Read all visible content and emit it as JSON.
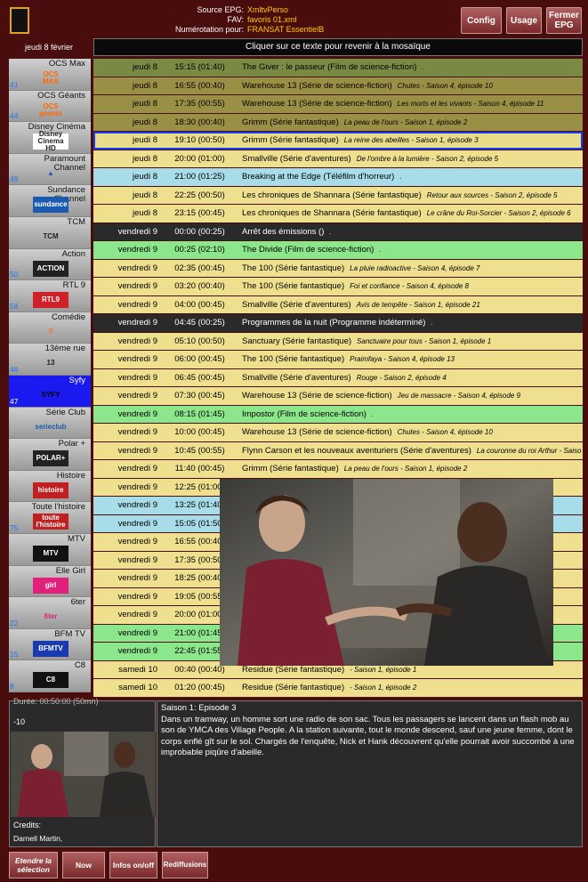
{
  "header": {
    "source_label": "Source EPG:",
    "source_value": "XmltvPerso",
    "fav_label": "FAV:",
    "fav_value": "favoris 01.xml",
    "num_label": "Numérotation pour:",
    "num_value": "FRANSAT EssentielB",
    "config": "Config",
    "usage": "Usage",
    "close_epg": "Fermer EPG"
  },
  "date_label": "jeudi 8 février",
  "mosaic_hint": "Cliquer sur ce texte pour revenir à la mosaïque",
  "channels": [
    {
      "name": "OCS Max",
      "num": "41",
      "logo": "OCS\nMAX",
      "logo_color": "#ff6a00",
      "logo_bg": "transparent"
    },
    {
      "name": "OCS Géants",
      "num": "44",
      "logo": "OCS\ngéants",
      "logo_color": "#ff6a00",
      "logo_bg": "transparent"
    },
    {
      "name": "Disney Cinéma",
      "num": "",
      "logo": "Disney\nCinema HD",
      "logo_color": "#222",
      "logo_bg": "#fff"
    },
    {
      "name": "Paramount\nChannel",
      "num": "49",
      "logo": "▲",
      "logo_color": "#1a5ab0",
      "logo_bg": "transparent"
    },
    {
      "name": "Sundance\nChannel",
      "num": "",
      "logo": "sundance",
      "logo_color": "#fff",
      "logo_bg": "#1a5ab0"
    },
    {
      "name": "TCM",
      "num": "",
      "logo": "TCM",
      "logo_color": "#222",
      "logo_bg": "transparent"
    },
    {
      "name": "Action",
      "num": "50",
      "logo": "ACTION",
      "logo_color": "#fff",
      "logo_bg": "#222"
    },
    {
      "name": "RTL 9",
      "num": "58",
      "logo": "RTL9",
      "logo_color": "#fff",
      "logo_bg": "#d0202a"
    },
    {
      "name": "Comédie",
      "num": "",
      "logo": "!!",
      "logo_color": "#ff6a00",
      "logo_bg": "transparent"
    },
    {
      "name": "13ème rue",
      "num": "46",
      "logo": "13",
      "logo_color": "#222",
      "logo_bg": "transparent"
    },
    {
      "name": "Syfy",
      "num": "47",
      "logo": "SYFY",
      "logo_color": "#000",
      "logo_bg": "transparent",
      "selected": true
    },
    {
      "name": "Série Club",
      "num": "",
      "logo": "serieclub",
      "logo_color": "#1a5ab0",
      "logo_bg": "transparent"
    },
    {
      "name": "Polar +",
      "num": "",
      "logo": "POLAR+",
      "logo_color": "#fff",
      "logo_bg": "#222"
    },
    {
      "name": "Histoire",
      "num": "",
      "logo": "histoire",
      "logo_color": "#fff",
      "logo_bg": "#c02020"
    },
    {
      "name": "Toute l'histoire",
      "num": "75",
      "logo": "toute\nl'histoire",
      "logo_color": "#fff",
      "logo_bg": "#c02020"
    },
    {
      "name": "MTV",
      "num": "",
      "logo": "MTV",
      "logo_color": "#fff",
      "logo_bg": "#111"
    },
    {
      "name": "Elle Girl",
      "num": "",
      "logo": "girl",
      "logo_color": "#fff",
      "logo_bg": "#e0207a"
    },
    {
      "name": "6ter",
      "num": "22",
      "logo": "6ter",
      "logo_color": "#e0207a",
      "logo_bg": "transparent"
    },
    {
      "name": "BFM TV",
      "num": "15",
      "logo": "BFMTV",
      "logo_color": "#fff",
      "logo_bg": "#1a3ab0"
    },
    {
      "name": "C8",
      "num": "8",
      "logo": "C8",
      "logo_color": "#fff",
      "logo_bg": "#111"
    }
  ],
  "colors": {
    "yellow": "#efe090",
    "olive": "#9a9045",
    "green": "#7a8a45",
    "lightgreen": "#8ce68c",
    "blue": "#a8dce8",
    "dark": "#2a2a2a",
    "current": "#e8dd8a"
  },
  "rows": [
    {
      "d": "jeudi 8",
      "t": "15:15 (01:40)",
      "ti": "The Giver : le passeur  (Film de science-fiction)",
      "ep": " .",
      "c": "green"
    },
    {
      "d": "jeudi 8",
      "t": "16:55 (00:40)",
      "ti": "Warehouse 13  (Série de science-fiction)",
      "ep": "Chutes - Saison 4, épisode 10",
      "c": "olive"
    },
    {
      "d": "jeudi 8",
      "t": "17:35 (00:55)",
      "ti": "Warehouse 13  (Série de science-fiction)",
      "ep": "Les morts et les vivants - Saison 4, épisode 11",
      "c": "olive"
    },
    {
      "d": "jeudi 8",
      "t": "18:30 (00:40)",
      "ti": "Grimm  (Série fantastique)",
      "ep": "La peau de l'ours - Saison 1, épisode 2",
      "c": "olive"
    },
    {
      "d": "jeudi 8",
      "t": "19:10 (00:50)",
      "ti": "Grimm  (Série fantastique)",
      "ep": "La reine des abeilles - Saison 1, épisode 3",
      "c": "current",
      "cur": true
    },
    {
      "d": "jeudi 8",
      "t": "20:00 (01:00)",
      "ti": "Smallville  (Série d'aventures)",
      "ep": "De l'ombre à la lumière - Saison 2, épisode 5",
      "c": "yellow"
    },
    {
      "d": "jeudi 8",
      "t": "21:00 (01:25)",
      "ti": "Breaking at the Edge  (Téléfilm d'horreur)",
      "ep": " .",
      "c": "blue"
    },
    {
      "d": "jeudi 8",
      "t": "22:25 (00:50)",
      "ti": "Les chroniques de Shannara  (Série fantastique)",
      "ep": "Retour aux sources - Saison 2, épisode 5",
      "c": "yellow"
    },
    {
      "d": "jeudi 8",
      "t": "23:15 (00:45)",
      "ti": "Les chroniques de Shannara  (Série fantastique)",
      "ep": "Le crâne du Roi-Sorcier - Saison 2, épisode 6",
      "c": "yellow"
    },
    {
      "d": "vendredi 9",
      "t": "00:00 (00:25)",
      "ti": "Arrêt des émissions  ()",
      "ep": " .",
      "c": "dark"
    },
    {
      "d": "vendredi 9",
      "t": "00:25 (02:10)",
      "ti": "The Divide  (Film de science-fiction)",
      "ep": " .",
      "c": "lightgreen"
    },
    {
      "d": "vendredi 9",
      "t": "02:35 (00:45)",
      "ti": "The 100  (Série fantastique)",
      "ep": "La pluie radioactive - Saison 4, épisode 7",
      "c": "yellow"
    },
    {
      "d": "vendredi 9",
      "t": "03:20 (00:40)",
      "ti": "The 100  (Série fantastique)",
      "ep": "Foi et confiance - Saison 4, épisode 8",
      "c": "yellow"
    },
    {
      "d": "vendredi 9",
      "t": "04:00 (00:45)",
      "ti": "Smallville  (Série d'aventures)",
      "ep": "Avis de tempête - Saison 1, épisode 21",
      "c": "yellow"
    },
    {
      "d": "vendredi 9",
      "t": "04:45 (00:25)",
      "ti": "Programmes de la nuit  (Programme indéterminé)",
      "ep": " .",
      "c": "dark"
    },
    {
      "d": "vendredi 9",
      "t": "05:10 (00:50)",
      "ti": "Sanctuary  (Série fantastique)",
      "ep": "Sanctuaire pour tous - Saison 1, épisode 1",
      "c": "yellow"
    },
    {
      "d": "vendredi 9",
      "t": "06:00 (00:45)",
      "ti": "The 100  (Série fantastique)",
      "ep": "Praimfaya - Saison 4, épisode 13",
      "c": "yellow"
    },
    {
      "d": "vendredi 9",
      "t": "06:45 (00:45)",
      "ti": "Smallville  (Série d'aventures)",
      "ep": "Rouge - Saison 2, épisode 4",
      "c": "yellow"
    },
    {
      "d": "vendredi 9",
      "t": "07:30 (00:45)",
      "ti": "Warehouse 13  (Série de science-fiction)",
      "ep": "Jeu de massacre - Saison 4, épisode 9",
      "c": "yellow"
    },
    {
      "d": "vendredi 9",
      "t": "08:15 (01:45)",
      "ti": "Impostor  (Film de science-fiction)",
      "ep": " .",
      "c": "lightgreen"
    },
    {
      "d": "vendredi 9",
      "t": "10:00 (00:45)",
      "ti": "Warehouse 13  (Série de science-fiction)",
      "ep": "Chutes - Saison 4, épisode 10",
      "c": "yellow"
    },
    {
      "d": "vendredi 9",
      "t": "10:45 (00:55)",
      "ti": "Flynn Carson et les nouveaux aventuriers  (Série d'aventures)",
      "ep": "La couronne du roi Arthur - Saiso",
      "c": "yellow"
    },
    {
      "d": "vendredi 9",
      "t": "11:40 (00:45)",
      "ti": "Grimm  (Série fantastique)",
      "ep": "La peau de l'ours - Saison 1, épisode 2",
      "c": "yellow"
    },
    {
      "d": "vendredi 9",
      "t": "12:25 (01:00)",
      "ti": "",
      "ep": "",
      "c": "yellow"
    },
    {
      "d": "vendredi 9",
      "t": "13:25 (01:40)",
      "ti": "",
      "ep": "",
      "c": "blue"
    },
    {
      "d": "vendredi 9",
      "t": "15:05 (01:50)",
      "ti": "",
      "ep": "",
      "c": "blue"
    },
    {
      "d": "vendredi 9",
      "t": "16:55 (00:40)",
      "ti": "",
      "ep": "",
      "c": "yellow"
    },
    {
      "d": "vendredi 9",
      "t": "17:35 (00:50)",
      "ti": "",
      "ep": "",
      "c": "yellow"
    },
    {
      "d": "vendredi 9",
      "t": "18:25 (00:40)",
      "ti": "",
      "ep": "",
      "c": "yellow"
    },
    {
      "d": "vendredi 9",
      "t": "19:05 (00:55)",
      "ti": "",
      "ep": "",
      "c": "yellow"
    },
    {
      "d": "vendredi 9",
      "t": "20:00 (01:00)",
      "ti": "",
      "ep": "",
      "c": "yellow"
    },
    {
      "d": "vendredi 9",
      "t": "21:00 (01:45)",
      "ti": "",
      "ep": "",
      "c": "lightgreen"
    },
    {
      "d": "vendredi 9",
      "t": "22:45 (01:55)",
      "ti": "",
      "ep": "",
      "c": "lightgreen"
    },
    {
      "d": "samedi 10",
      "t": "00:40 (00:40)",
      "ti": "Residue  (Série fantastique)",
      "ep": " - Saison 1, épisode 1",
      "c": "yellow"
    },
    {
      "d": "samedi 10",
      "t": "01:20 (00:45)",
      "ti": "Residue  (Série fantastique)",
      "ep": " - Saison 1, épisode 2",
      "c": "yellow"
    }
  ],
  "info": {
    "duration": "Durée: 00:50:00 (50mn)",
    "rating": "-10",
    "credits_label": "Credits:",
    "credits": "Darnell Martin,",
    "episode_title": "Saison 1: Episode 3",
    "synopsis": "Dans un tramway, un homme sort une radio de son sac. Tous les passagers se lancent dans un flash mob au son de YMCA des Village People. A la station suivante, tout le monde descend, sauf une jeune femme, dont le corps enflé gît sur le sol. Chargés de l'enquête, Nick et Hank découvrent qu'elle pourrait avoir succombé à une improbable piqûre d'abeille."
  },
  "footer": {
    "extend": "Etendre la sélection",
    "now": "Now",
    "infos": "Infos on/off",
    "rediff": "Rediffusions"
  }
}
